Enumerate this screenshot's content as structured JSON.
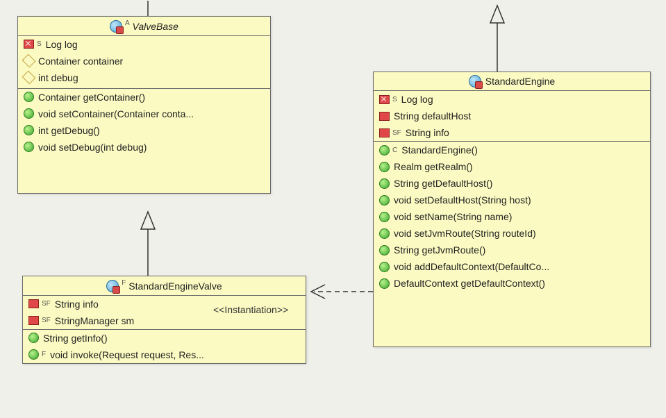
{
  "classes": {
    "valveBase": {
      "name": "ValveBase",
      "stereotypeLetter": "A",
      "fields": [
        {
          "icon": "redbox-x",
          "sup": "S",
          "text": "Log log"
        },
        {
          "icon": "diamond",
          "sup": "",
          "text": "Container container"
        },
        {
          "icon": "diamond",
          "sup": "",
          "text": "int debug"
        }
      ],
      "methods": [
        {
          "icon": "green",
          "sup": "",
          "text": "Container getContainer()"
        },
        {
          "icon": "green",
          "sup": "",
          "text": "void setContainer(Container conta..."
        },
        {
          "icon": "green",
          "sup": "",
          "text": "int getDebug()"
        },
        {
          "icon": "green",
          "sup": "",
          "text": "void setDebug(int debug)"
        }
      ]
    },
    "standardEngineValve": {
      "name": "StandardEngineValve",
      "stereotypeLetter": "F",
      "fields": [
        {
          "icon": "redbox",
          "sup": "SF",
          "text": "String info"
        },
        {
          "icon": "redbox",
          "sup": "SF",
          "text": "StringManager sm"
        }
      ],
      "methods": [
        {
          "icon": "green",
          "sup": "",
          "text": "String getInfo()"
        },
        {
          "icon": "green",
          "sup": "F",
          "text": "void invoke(Request request, Res..."
        }
      ]
    },
    "standardEngine": {
      "name": "StandardEngine",
      "stereotypeLetter": "",
      "fields": [
        {
          "icon": "redbox-x",
          "sup": "S",
          "text": "Log log"
        },
        {
          "icon": "redbox",
          "sup": "",
          "text": "String defaultHost"
        },
        {
          "icon": "redbox",
          "sup": "SF",
          "text": "String info"
        }
      ],
      "methods": [
        {
          "icon": "green",
          "sup": "C",
          "text": "StandardEngine()"
        },
        {
          "icon": "green",
          "sup": "",
          "text": "Realm getRealm()"
        },
        {
          "icon": "green",
          "sup": "",
          "text": "String getDefaultHost()"
        },
        {
          "icon": "green",
          "sup": "",
          "text": "void setDefaultHost(String host)"
        },
        {
          "icon": "green",
          "sup": "",
          "text": "void setName(String name)"
        },
        {
          "icon": "green",
          "sup": "",
          "text": "void setJvmRoute(String routeId)"
        },
        {
          "icon": "green",
          "sup": "",
          "text": "String getJvmRoute()"
        },
        {
          "icon": "green",
          "sup": "",
          "text": " void addDefaultContext(DefaultCo..."
        },
        {
          "icon": "green",
          "sup": "",
          "text": "DefaultContext getDefaultContext()"
        }
      ]
    }
  },
  "relations": {
    "instantiation": "<<Instantiation>>"
  }
}
